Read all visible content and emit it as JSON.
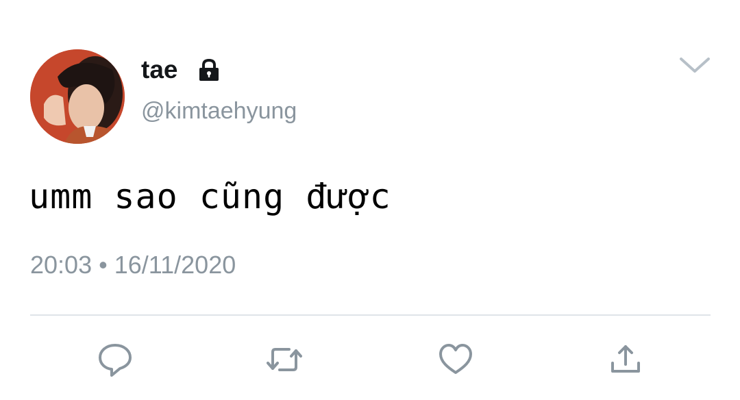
{
  "tweet": {
    "display_name": "tae",
    "handle": "@kimtaehyung",
    "text": "umm sao cũng được",
    "time": "20:03",
    "separator": "•",
    "date": "16/11/2020"
  },
  "icons": {
    "protected": "lock-icon",
    "menu": "chevron-down-icon",
    "actions": [
      "reply-icon",
      "retweet-icon",
      "like-icon",
      "share-icon"
    ]
  },
  "colors": {
    "primary_text": "#14171a",
    "secondary_text": "#8a959e",
    "divider": "#dfe4e8",
    "icon": "#8a959e"
  }
}
